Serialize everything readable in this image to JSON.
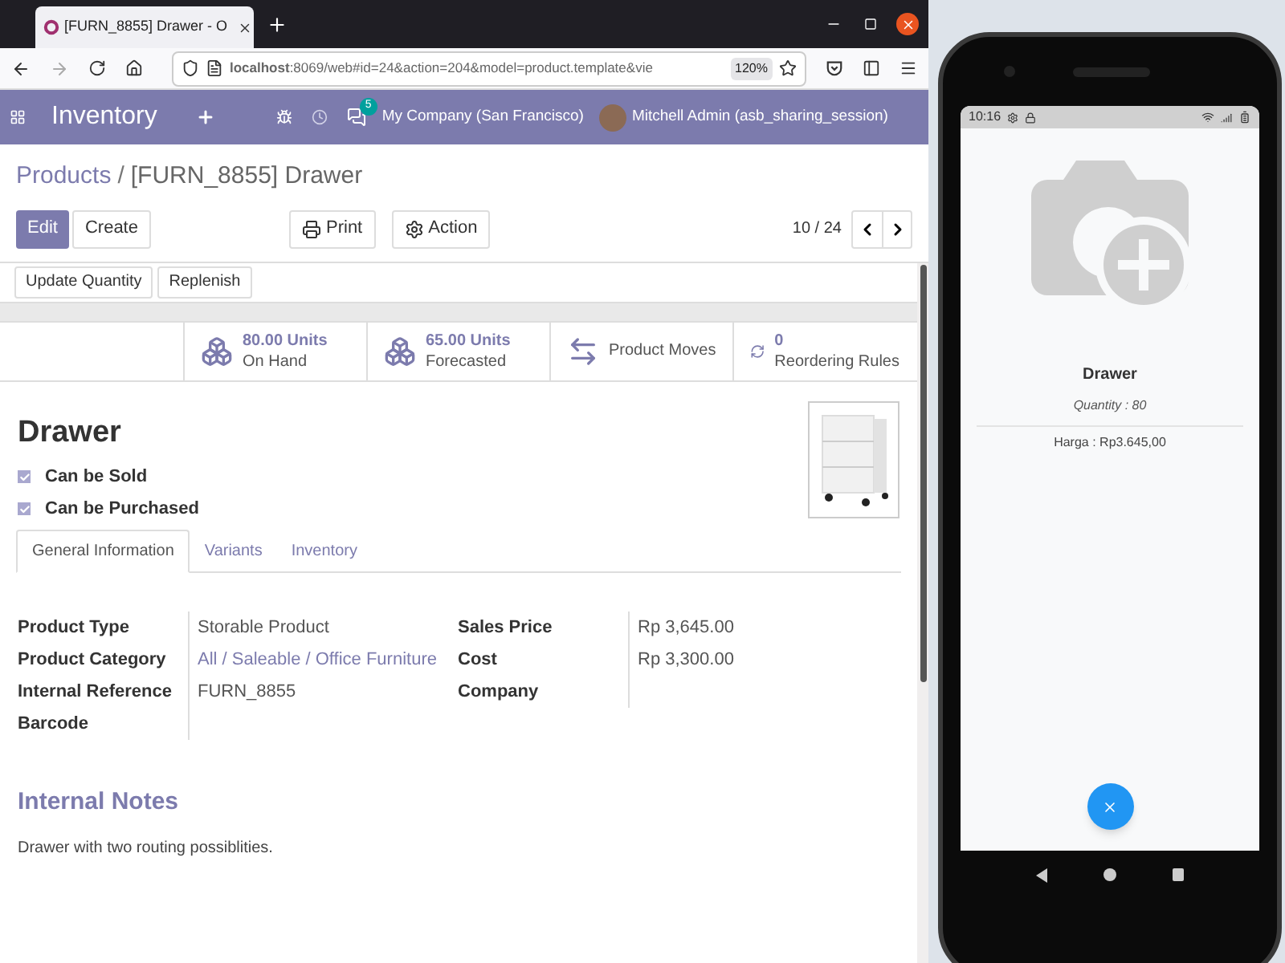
{
  "browser": {
    "tab_title": "[FURN_8855] Drawer - O",
    "url": "**localhost**:8069/web#id=24&action=204&model=product.template&vie",
    "zoom": "120%"
  },
  "navbar": {
    "app": "Inventory",
    "message_count": "5",
    "company": "My Company (San Francisco)",
    "user": "Mitchell Admin (asb_sharing_session)"
  },
  "breadcrumb": {
    "parent": "Products",
    "separator": "/",
    "current": "[FURN_8855] Drawer"
  },
  "control_buttons": [
    {
      "label": "Edit",
      "kind": "primary"
    },
    {
      "label": "Create",
      "kind": "plain"
    }
  ],
  "menus": [
    {
      "label": "Print",
      "kind": "print"
    },
    {
      "label": "Action",
      "kind": "gear"
    }
  ],
  "pager": "10 / 24",
  "header_buttons": [
    "Update Quantity",
    "Replenish"
  ],
  "smart_buttons": [
    {
      "kind": "cubes",
      "value": "80.00 Units",
      "label": "On Hand"
    },
    {
      "kind": "cubes",
      "value": "65.00 Units",
      "label": "Forecasted"
    },
    {
      "kind": "moves",
      "label": "Product Moves"
    },
    {
      "kind": "refresh",
      "value": "0",
      "label": "Reordering Rules"
    }
  ],
  "product_name": "Drawer",
  "options": [
    {
      "label": "Can be Sold",
      "checked": true
    },
    {
      "label": "Can be Purchased",
      "checked": true
    }
  ],
  "tabs": [
    {
      "label": "General Information",
      "selected": true
    },
    {
      "label": "Variants",
      "selected": false
    },
    {
      "label": "Inventory",
      "selected": false
    }
  ],
  "fields_left": [
    {
      "label": "Product Type",
      "value": "Storable Product"
    },
    {
      "label": "Product Category",
      "value": "All / Saleable / Office Furniture",
      "link": true
    },
    {
      "label": "Internal Reference",
      "value": "FURN_8855"
    },
    {
      "label": "Barcode"
    }
  ],
  "fields_right": [
    {
      "label": "Sales Price",
      "value": "Rp 3,645.00"
    },
    {
      "label": "Cost",
      "value": "Rp 3,300.00"
    },
    {
      "label": "Company"
    }
  ],
  "notes": {
    "title": "Internal Notes",
    "text": "Drawer with two routing possiblities."
  },
  "phone": {
    "time": "10:16",
    "product_name": "Drawer",
    "quantity": "Quantity : 80",
    "price": "Harga : Rp3.645,00"
  }
}
